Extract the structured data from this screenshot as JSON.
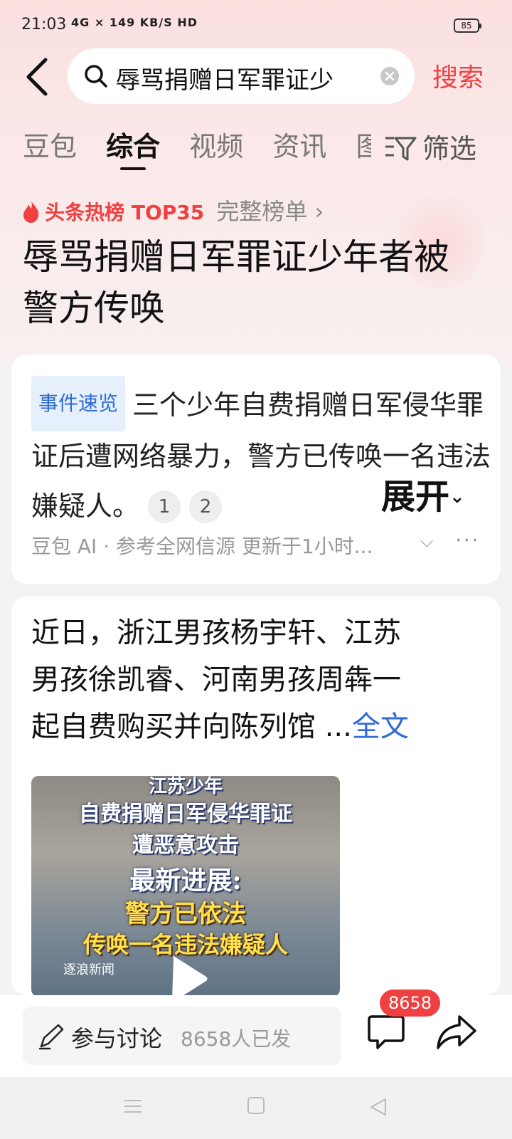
{
  "status": {
    "time": "21:03",
    "network": "4G ×  149 KB/S HD",
    "battery": "85"
  },
  "search": {
    "query": "辱骂捐赠日军罪证少",
    "button": "搜索"
  },
  "tabs": [
    {
      "label": "豆包"
    },
    {
      "label": "综合",
      "active": true
    },
    {
      "label": "视频"
    },
    {
      "label": "资讯"
    },
    {
      "label": "图"
    }
  ],
  "filter": {
    "label": "筛选"
  },
  "hot": {
    "label": "头条热榜 TOP35",
    "more": "完整榜单 ›"
  },
  "headline": "辱骂捐赠日军罪证少年者被警方传唤",
  "ai_card": {
    "tag": "事件速览",
    "summary": "三个少年自费捐赠日军侵华罪证后遭网络暴力，警方已传唤一名违法嫌疑人。",
    "cites": [
      "1",
      "2"
    ],
    "expand": "展开",
    "source": "豆包 AI · 参考全网信源 更新于1小时..."
  },
  "article": {
    "lines": [
      "近日，浙江男孩杨宇轩、江苏",
      "男孩徐凯睿、河南男孩周犇一",
      "起自费购买并向陈列馆 ..."
    ],
    "fulltext": "全文",
    "video_lines": [
      "江苏少年",
      "自费捐赠日军侵华罪证",
      "遭恶意攻击",
      "最新进展:",
      "警方已依法",
      "传唤一名违法嫌疑人"
    ],
    "video_logo": "逐浪新闻"
  },
  "bottom": {
    "discuss_label": "参与讨论",
    "discuss_count": "8658人已发",
    "comment_badge": "8658"
  },
  "colors": {
    "accent": "#f04142",
    "link": "#2d6bd6"
  }
}
